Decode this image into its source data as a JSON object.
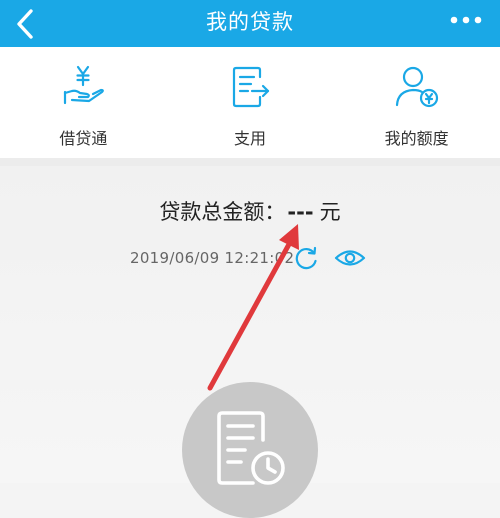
{
  "header": {
    "title": "我的贷款",
    "back_icon": "chevron-left-icon",
    "more_icon": "more-dots-icon",
    "color": "#1aa8e6"
  },
  "shortcuts": [
    {
      "label": "借贷通",
      "icon": "hand-yen-icon"
    },
    {
      "label": "支用",
      "icon": "document-transfer-icon"
    },
    {
      "label": "我的额度",
      "icon": "user-yen-icon"
    }
  ],
  "summary": {
    "label": "贷款总金额：",
    "amount": "---",
    "unit": "元",
    "timestamp": "2019/06/09 12:21:02",
    "refresh_icon": "refresh-icon",
    "visibility_icon": "eye-icon"
  },
  "annotation": {
    "arrow_color": "#e0393c"
  },
  "record_button": {
    "icon": "document-clock-icon"
  }
}
